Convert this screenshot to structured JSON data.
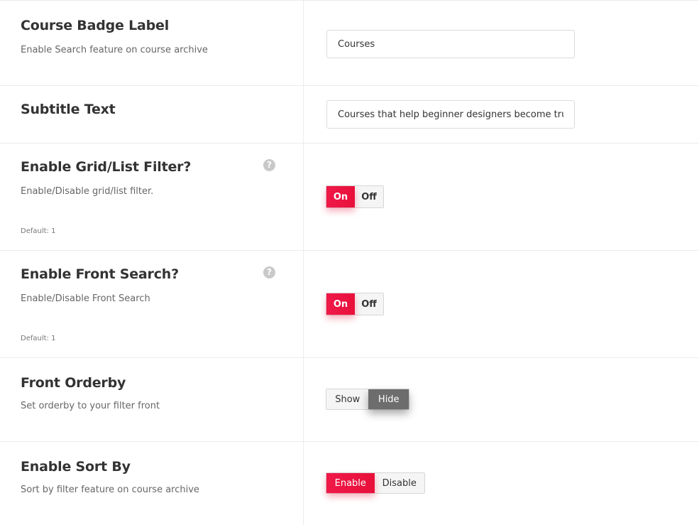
{
  "settings": [
    {
      "title": "Course Badge Label",
      "description": "Enable Search feature on course archive",
      "input_value": "Courses"
    },
    {
      "title": "Subtitle Text",
      "input_value": "Courses that help beginner designers become true unicorns."
    },
    {
      "title": "Enable Grid/List Filter?",
      "description": "Enable/Disable grid/list filter.",
      "default": "Default: 1",
      "help": "?",
      "options": [
        "On",
        "Off"
      ],
      "selected": "On"
    },
    {
      "title": "Enable Front Search?",
      "description": "Enable/Disable Front Search",
      "default": "Default: 1",
      "help": "?",
      "options": [
        "On",
        "Off"
      ],
      "selected": "On"
    },
    {
      "title": "Front Orderby",
      "description": "Set orderby to your filter front",
      "options": [
        "Show",
        "Hide"
      ],
      "selected": "Hide"
    },
    {
      "title": "Enable Sort By",
      "description": "Sort by filter feature on course archive",
      "options": [
        "Enable",
        "Disable"
      ],
      "selected": "Enable"
    }
  ],
  "colors": {
    "accent": "#e8103a",
    "active_grey": "#6d6d6d",
    "divider": "#ececec"
  }
}
